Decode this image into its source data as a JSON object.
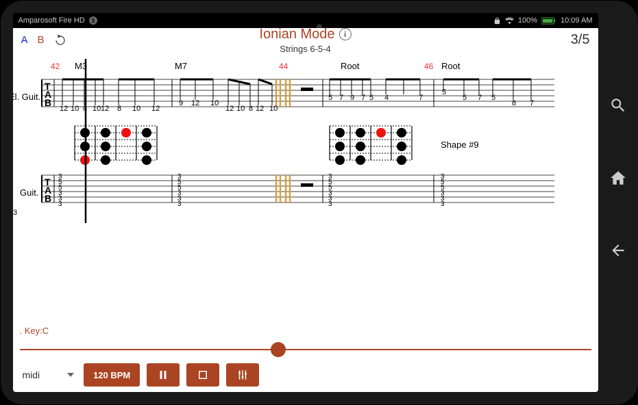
{
  "statusbar": {
    "device": "Amparosoft Fire HD",
    "notif": "3",
    "battery": "100%",
    "time": "10:09 AM"
  },
  "header": {
    "a": "A",
    "b": "B",
    "title": "Ionian Mode",
    "subtitle": "Strings 6-5-4",
    "page": "3/5"
  },
  "score": {
    "track1": "El. Guit.",
    "track2": "Guit.",
    "bar_numbers": [
      "42",
      "44",
      "46"
    ],
    "interval_labels": [
      "M3",
      "M7",
      "Root",
      "Root"
    ],
    "shape_label": "Shape #9",
    "tab1_bar1": [
      "12",
      "10",
      "8",
      "10",
      "12",
      "8",
      "10",
      "12"
    ],
    "tab1_bar2a": [
      "9",
      "12",
      "10"
    ],
    "tab1_bar2b": [
      "12",
      "10",
      "8",
      "12",
      "10"
    ],
    "tab1_bar3": [
      "5",
      "7",
      "9",
      "7",
      "5",
      "4",
      "7"
    ],
    "tab1_bar4": [
      "5",
      "5",
      "7",
      "5",
      "8",
      "7"
    ],
    "tab2_chord": [
      "3",
      "5",
      "5",
      "3",
      "3",
      "3"
    ],
    "lower_left": "3"
  },
  "footer": {
    "key": ". Key:C",
    "midi": "midi",
    "bpm": "120 BPM"
  }
}
